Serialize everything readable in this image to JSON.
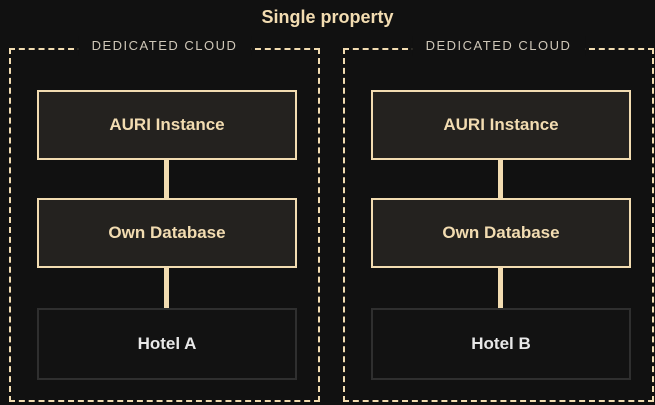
{
  "title": "Single property",
  "clouds": [
    {
      "label": "DEDICATED CLOUD",
      "nodes": [
        "AURI Instance",
        "Own Database",
        "Hotel A"
      ]
    },
    {
      "label": "DEDICATED CLOUD",
      "nodes": [
        "AURI Instance",
        "Own Database",
        "Hotel B"
      ]
    }
  ],
  "colors": {
    "background": "#111111",
    "accent": "#f2dcb1",
    "node_fill": "#24221f",
    "muted_border": "#2f2f2f"
  }
}
